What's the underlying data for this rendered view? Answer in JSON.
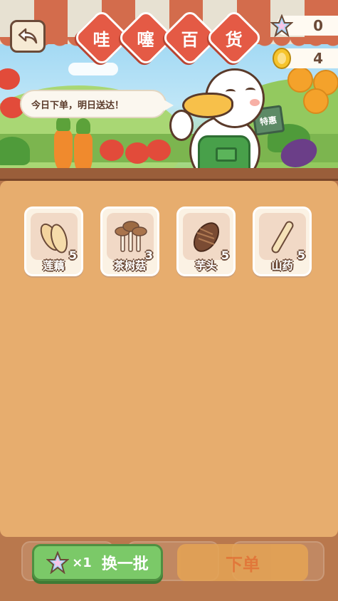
{
  "header": {
    "title_chars": [
      "哇",
      "噻",
      "百",
      "货"
    ],
    "bubble_text": "今日下单，明日送达！",
    "sign_text": "特惠"
  },
  "currency": {
    "stars": "0",
    "coins": "4"
  },
  "items": [
    {
      "name": "莲藕",
      "qty": "5",
      "icon": "lotus-root-icon"
    },
    {
      "name": "茶树菇",
      "qty": "3",
      "icon": "mushroom-icon"
    },
    {
      "name": "芋头",
      "qty": "5",
      "icon": "taro-icon"
    },
    {
      "name": "山药",
      "qty": "5",
      "icon": "yam-icon"
    }
  ],
  "bottom": {
    "refresh_multiplier": "×1",
    "refresh_label": "换一批",
    "order_label": "下单"
  },
  "colors": {
    "accent_red": "#e45a45",
    "panel": "#e7ad6e",
    "green_button": "#7bc968",
    "order_button": "#e5a455"
  }
}
